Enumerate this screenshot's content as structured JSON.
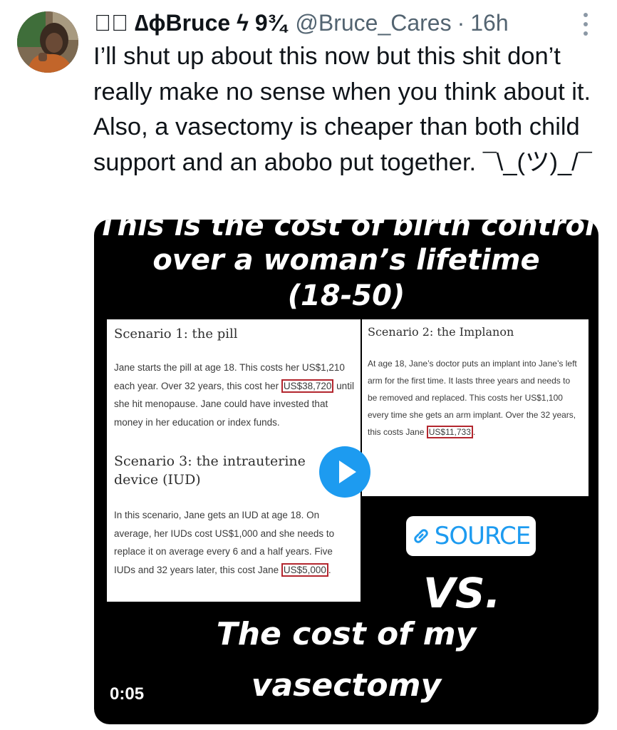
{
  "tweet": {
    "display_name": "ꝺ᳑ ∆ɸBruce ϟ 9¾",
    "handle": "@Bruce_Cares",
    "separator": "·",
    "timestamp": "16h",
    "text": "I’ll shut up about this now but this shit don’t really make no sense when you think about it. Also, a vasectomy is cheaper than both child support and an abobo put together. ¯\\_(ツ)_/¯",
    "more_icon": "more-vertical-icon"
  },
  "media": {
    "heading_line1": "This is the cost of birth control",
    "heading_line2": "over a woman’s lifetime",
    "heading_line3": "(18-50)",
    "scenario1": {
      "title": "Scenario 1: the pill",
      "body_pre": "Jane starts the pill at age 18. This costs her US$1,210 each year. Over 32 years, this cost her ",
      "amount": "US$38,720",
      "body_post": " until she hit menopause. Jane could have invested that money in her education or index funds."
    },
    "scenario2": {
      "title": "Scenario 2: the Implanon",
      "body_pre": "At age 18, Jane’s doctor puts an implant into Jane’s left arm for the first time. It lasts three years and needs to be removed and replaced. This costs her US$1,100 every time she gets an arm implant. Over the 32 years, this costs Jane ",
      "amount": "US$11,733",
      "body_post": "."
    },
    "scenario3": {
      "title": "Scenario 3: the intrauterine device (IUD)",
      "body_pre": "In this scenario, Jane gets an IUD at age 18. On average, her IUDs cost US$1,000 and she needs to replace it on average every 6 and a half years. Five IUDs and 32 years later, this cost Jane ",
      "amount": "US$5,000",
      "body_post": "."
    },
    "source_sticker": "SOURCE",
    "vs": "VS.",
    "footer_line1": "The cost of my",
    "footer_line2": "vasectomy",
    "timer": "0:05",
    "play_icon": "play-icon",
    "link_icon": "link-icon"
  },
  "colors": {
    "accent": "#1d9bf0",
    "highlight_box": "#b3262e",
    "secondary_text": "#536471"
  }
}
